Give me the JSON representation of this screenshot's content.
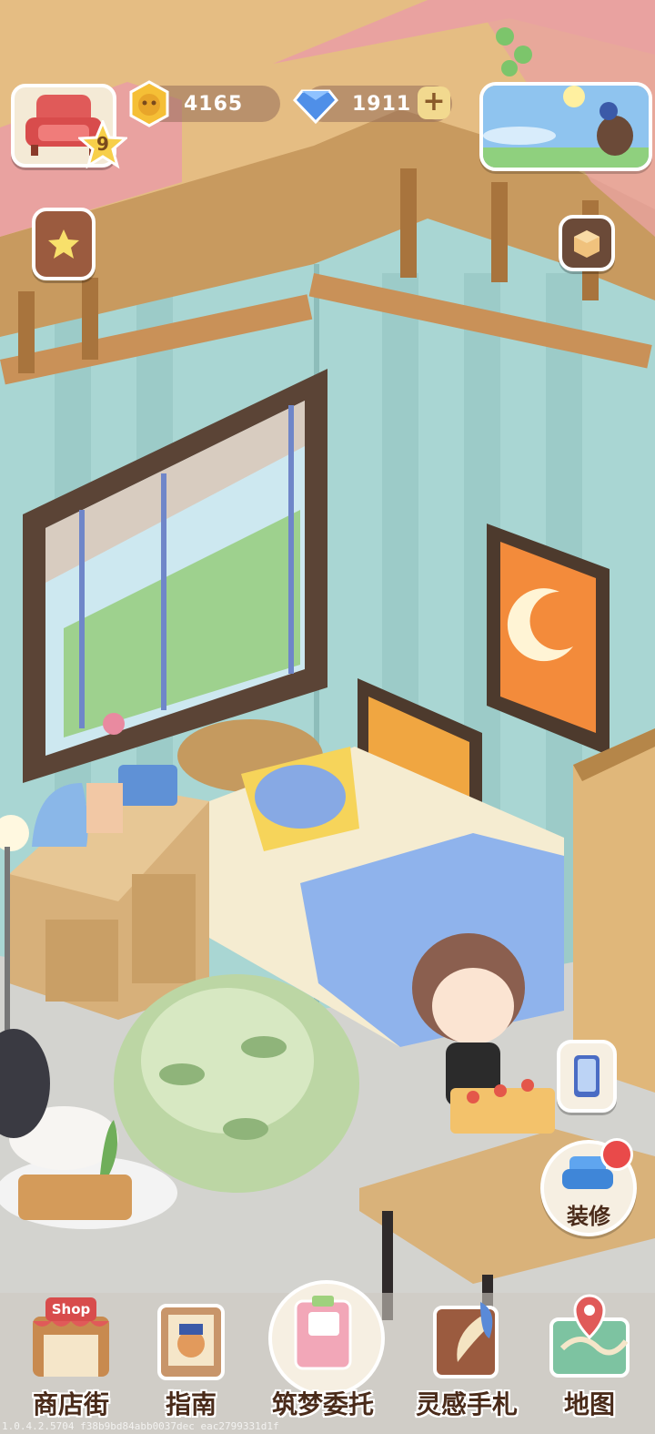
{
  "hud": {
    "level": "9",
    "coins": "4165",
    "gems": "1911",
    "add_symbol": "+"
  },
  "nav": {
    "shop_sign": "Shop",
    "shop_street": "商店街",
    "guide": "指南",
    "dream_commission": "筑梦委托",
    "inspiration_notebook": "灵感手札",
    "map": "地图"
  },
  "decorate_label": "装修",
  "build_id": "1.0.4.2.5704 f38b9bd84abb0037dec eac2799331d1f",
  "colors": {
    "wall": "#a9d6d3",
    "floor": "#d3d3cf",
    "wood": "#d9b27a",
    "roof": "#e9a2a0",
    "bedsheet": "#8fb3ec"
  }
}
